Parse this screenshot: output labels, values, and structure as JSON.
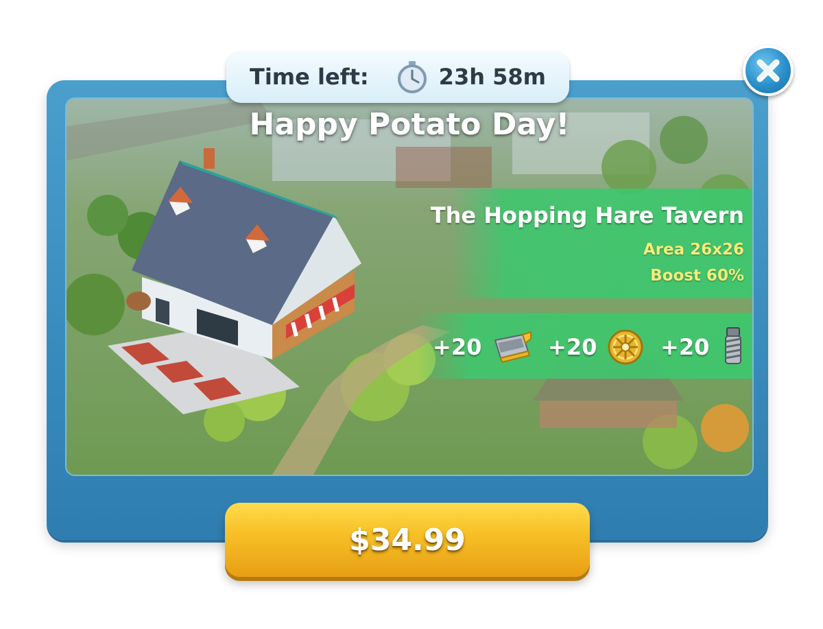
{
  "offer": {
    "title": "Happy Potato Day!",
    "timer": {
      "label": "Time left:",
      "value": "23h 58m",
      "icon": "stopwatch-icon"
    },
    "building": {
      "name": "The Hopping Hare Tavern",
      "area": "Area 26x26",
      "boost": "Boost 60%"
    },
    "rewards": [
      {
        "amount": "+20",
        "icon": "shovel-icon"
      },
      {
        "amount": "+20",
        "icon": "gear-wheel-icon"
      },
      {
        "amount": "+20",
        "icon": "bolt-icon"
      }
    ],
    "price": "$34.99",
    "close_icon": "close-icon"
  },
  "colors": {
    "panel": "#3a8cbd",
    "band": "#3cc86e",
    "stat_text": "#f6ec7a",
    "button": "#f7c127"
  }
}
